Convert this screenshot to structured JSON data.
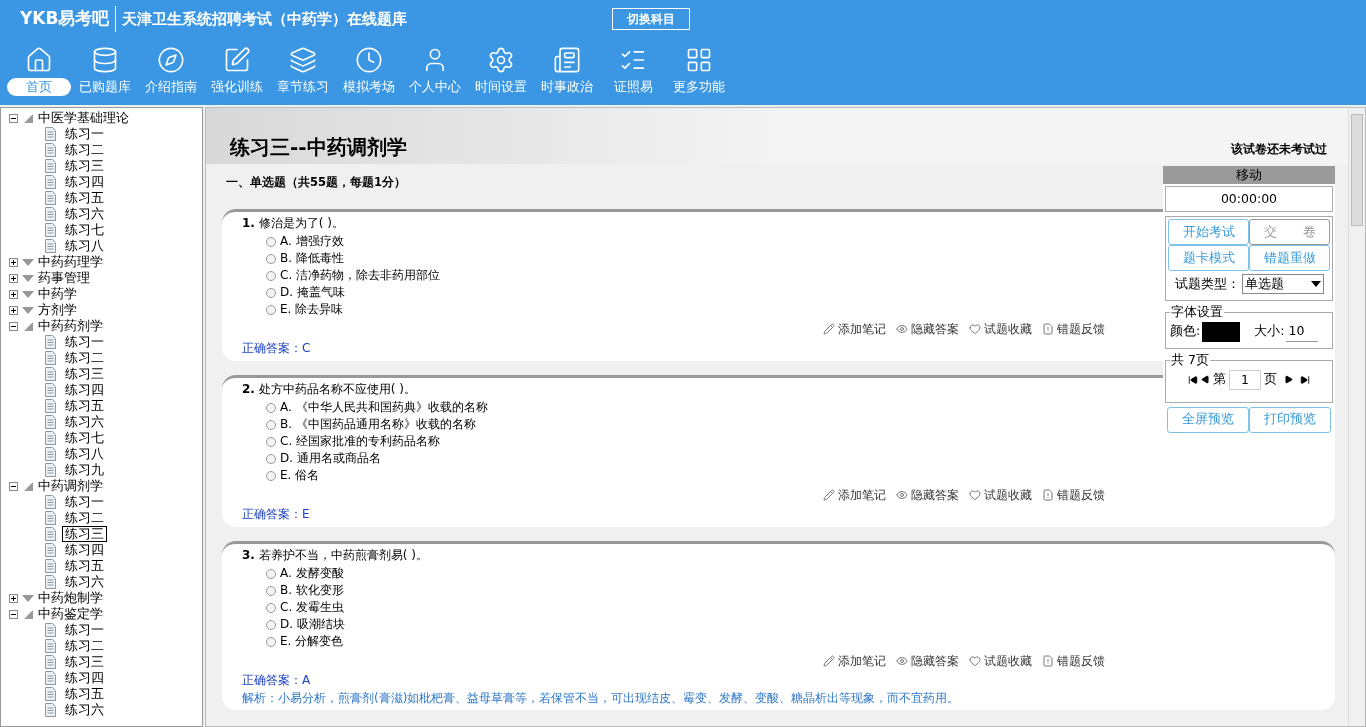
{
  "header": {
    "logo": "YKB易考吧",
    "title": "天津卫生系统招聘考试（中药学）在线题库",
    "switch_button": "切换科目"
  },
  "nav": [
    {
      "label": "首页",
      "selected": true
    },
    {
      "label": "已购题库",
      "selected": false
    },
    {
      "label": "介绍指南",
      "selected": false
    },
    {
      "label": "强化训练",
      "selected": false
    },
    {
      "label": "章节练习",
      "selected": false
    },
    {
      "label": "模拟考场",
      "selected": false
    },
    {
      "label": "个人中心",
      "selected": false
    },
    {
      "label": "时间设置",
      "selected": false
    },
    {
      "label": "时事政治",
      "selected": false
    },
    {
      "label": "证照易",
      "selected": false
    },
    {
      "label": "更多功能",
      "selected": false
    }
  ],
  "tree": [
    {
      "label": "中医学基础理论",
      "expanded": true,
      "children": [
        {
          "label": "练习一",
          "selected": false
        },
        {
          "label": "练习二",
          "selected": false
        },
        {
          "label": "练习三",
          "selected": false
        },
        {
          "label": "练习四",
          "selected": false
        },
        {
          "label": "练习五",
          "selected": false
        },
        {
          "label": "练习六",
          "selected": false
        },
        {
          "label": "练习七",
          "selected": false
        },
        {
          "label": "练习八",
          "selected": false
        }
      ]
    },
    {
      "label": "中药药理学",
      "expanded": false
    },
    {
      "label": "药事管理",
      "expanded": false
    },
    {
      "label": "中药学",
      "expanded": false
    },
    {
      "label": "方剂学",
      "expanded": false
    },
    {
      "label": "中药药剂学",
      "expanded": true,
      "children": [
        {
          "label": "练习一",
          "selected": false
        },
        {
          "label": "练习二",
          "selected": false
        },
        {
          "label": "练习三",
          "selected": false
        },
        {
          "label": "练习四",
          "selected": false
        },
        {
          "label": "练习五",
          "selected": false
        },
        {
          "label": "练习六",
          "selected": false
        },
        {
          "label": "练习七",
          "selected": false
        },
        {
          "label": "练习八",
          "selected": false
        },
        {
          "label": "练习九",
          "selected": false
        }
      ]
    },
    {
      "label": "中药调剂学",
      "expanded": true,
      "children": [
        {
          "label": "练习一",
          "selected": false
        },
        {
          "label": "练习二",
          "selected": false
        },
        {
          "label": "练习三",
          "selected": true
        },
        {
          "label": "练习四",
          "selected": false
        },
        {
          "label": "练习五",
          "selected": false
        },
        {
          "label": "练习六",
          "selected": false
        }
      ]
    },
    {
      "label": "中药炮制学",
      "expanded": false
    },
    {
      "label": "中药鉴定学",
      "expanded": true,
      "children": [
        {
          "label": "练习一",
          "selected": false
        },
        {
          "label": "练习二",
          "selected": false
        },
        {
          "label": "练习三",
          "selected": false
        },
        {
          "label": "练习四",
          "selected": false
        },
        {
          "label": "练习五",
          "selected": false
        },
        {
          "label": "练习六",
          "selected": false
        }
      ]
    }
  ],
  "paper": {
    "title": "练习三--中药调剂学",
    "status": "该试卷还未考试过",
    "section": "一、单选题（共55题，每题1分）"
  },
  "questions": [
    {
      "number": "1.",
      "stem": "修治是为了( )。",
      "options": [
        {
          "text": "A. 增强疗效",
          "selected": false
        },
        {
          "text": "B. 降低毒性",
          "selected": false
        },
        {
          "text": "C. 洁净药物，除去非药用部位",
          "selected": false
        },
        {
          "text": "D. 掩盖气味",
          "selected": false
        },
        {
          "text": "E. 除去异味",
          "selected": false
        }
      ],
      "actions": [
        "添加笔记",
        "隐藏答案",
        "试题收藏",
        "错题反馈"
      ],
      "answer": "正确答案：C"
    },
    {
      "number": "2.",
      "stem": "处方中药品名称不应使用( )。",
      "options": [
        {
          "text": "A. 《中华人民共和国药典》收载的名称",
          "selected": false
        },
        {
          "text": "B. 《中国药品通用名称》收载的名称",
          "selected": false
        },
        {
          "text": "C. 经国家批准的专利药品名称",
          "selected": false
        },
        {
          "text": "D. 通用名或商品名",
          "selected": false
        },
        {
          "text": "E. 俗名",
          "selected": false
        }
      ],
      "actions": [
        "添加笔记",
        "隐藏答案",
        "试题收藏",
        "错题反馈"
      ],
      "answer": "正确答案：E"
    },
    {
      "number": "3.",
      "stem": "若养护不当，中药煎膏剂易( )。",
      "options": [
        {
          "text": "A. 发酵变酸",
          "selected": false
        },
        {
          "text": "B. 软化变形",
          "selected": false
        },
        {
          "text": "C. 发霉生虫",
          "selected": false
        },
        {
          "text": "D. 吸潮结块",
          "selected": false
        },
        {
          "text": "E. 分解变色",
          "selected": false
        }
      ],
      "actions": [
        "添加笔记",
        "隐藏答案",
        "试题收藏",
        "错题反馈"
      ],
      "answer": "正确答案：A",
      "explanation": "解析：小易分析，煎膏剂(膏滋)如枇杷膏、益母草膏等，若保管不当，可出现结皮、霉变、发酵、变酸、糖晶析出等现象，而不宜药用。"
    }
  ],
  "panel": {
    "title": "移动",
    "timer": "00:00:00",
    "buttons": [
      {
        "label": "开始考试",
        "disabled": false
      },
      {
        "label": "交　　卷",
        "disabled": true
      },
      {
        "label": "题卡模式",
        "disabled": false
      },
      {
        "label": "错题重做",
        "disabled": false
      }
    ],
    "type_label": "试题类型：",
    "type_value": "单选题",
    "font_legend": "字体设置",
    "color_label": "颜色:",
    "font_color_swatch": {
      "color": "#000000"
    },
    "size_label": "大小:",
    "size_value": "10",
    "pages_legend": "共 7页",
    "page_prefix": "第",
    "page_value": "1",
    "page_suffix": "页",
    "bottom_buttons": [
      "全屏预览",
      "打印预览"
    ]
  }
}
